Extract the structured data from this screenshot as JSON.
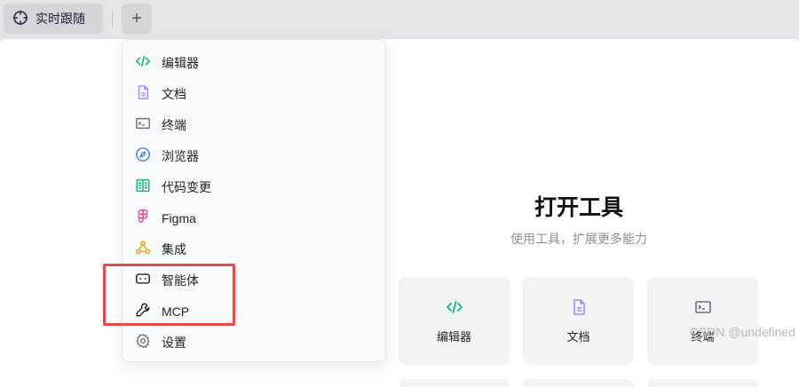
{
  "tabbar": {
    "active_tab": {
      "label": "实时跟随",
      "icon": "crosshair-icon"
    },
    "add_label": "+"
  },
  "menu": {
    "items": [
      {
        "label": "编辑器",
        "icon": "code-icon",
        "color": "#10b981"
      },
      {
        "label": "文档",
        "icon": "document-icon",
        "color": "#a78bfa"
      },
      {
        "label": "终端",
        "icon": "terminal-icon",
        "color": "#64748b"
      },
      {
        "label": "浏览器",
        "icon": "compass-icon",
        "color": "#3b82f6"
      },
      {
        "label": "代码变更",
        "icon": "diff-icon",
        "color": "#10b981"
      },
      {
        "label": "Figma",
        "icon": "figma-icon",
        "color": "#ec4899"
      },
      {
        "label": "集成",
        "icon": "integration-icon",
        "color": "#f59e0b"
      },
      {
        "label": "智能体",
        "icon": "agent-icon",
        "color": "#1f2329"
      },
      {
        "label": "MCP",
        "icon": "wrench-icon",
        "color": "#1f2329"
      },
      {
        "label": "设置",
        "icon": "gear-icon",
        "color": "#6b7280"
      }
    ]
  },
  "main": {
    "title": "打开工具",
    "subtitle": "使用工具，扩展更多能力",
    "cards": [
      {
        "label": "编辑器",
        "icon": "code-icon",
        "color": "#10b981"
      },
      {
        "label": "文档",
        "icon": "document-icon",
        "color": "#a78bfa"
      },
      {
        "label": "终端",
        "icon": "terminal-icon",
        "color": "#64748b"
      }
    ]
  },
  "watermark": "CSDN @undefined",
  "highlight_color": "#e84a4a"
}
